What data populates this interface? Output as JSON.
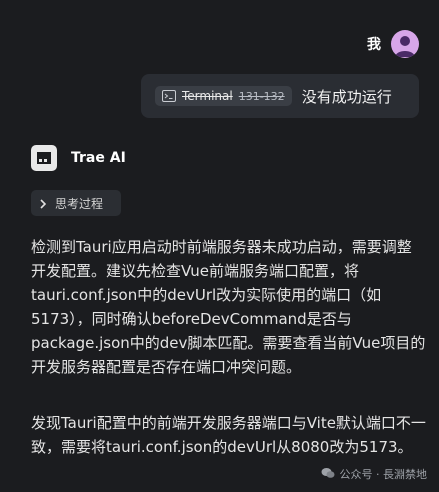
{
  "user": {
    "name": "我",
    "avatar_icon": "user-avatar-icon"
  },
  "message": {
    "attachment": {
      "icon": "terminal-icon",
      "label": "Terminal",
      "range": "131-132"
    },
    "text": "没有成功运行"
  },
  "assistant": {
    "name": "Trae AI",
    "logo_icon": "trae-logo-icon",
    "thinking_label": "思考过程",
    "paragraphs": [
      "检测到Tauri应用启动时前端服务器未成功启动，需要调整开发配置。建议先检查Vue前端服务端口配置，将tauri.conf.json中的devUrl改为实际使用的端口（如5173），同时确认beforeDevCommand是否与package.json中的dev脚本匹配。需要查看当前Vue项目的开发服务器配置是否存在端口冲突问题。",
      "发现Tauri配置中的前端开发服务器端口与Vite默认端口不一致，需要将tauri.conf.json的devUrl从8080改为5173。"
    ]
  },
  "watermark": "公众号 · 長淵禁地",
  "colors": {
    "background": "#1b1c1f",
    "bubble": "#2a2d33",
    "avatar": "#d7a6e8"
  }
}
